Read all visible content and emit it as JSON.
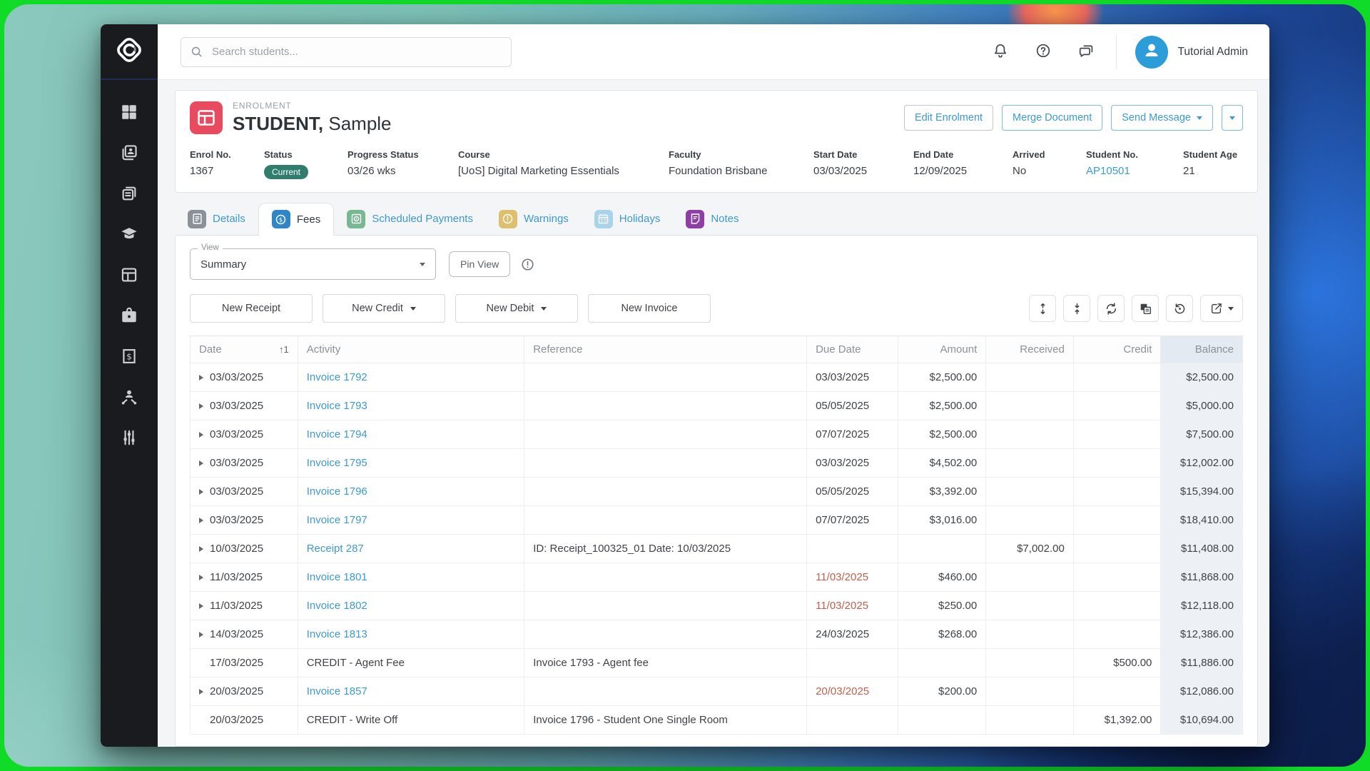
{
  "topbar": {
    "search_placeholder": "Search students...",
    "user_name": "Tutorial Admin",
    "icons": [
      "bell-icon",
      "help-icon",
      "chat-icon"
    ]
  },
  "sidebar": {
    "items": [
      {
        "id": "dashboard",
        "icon": "dashboard-icon"
      },
      {
        "id": "students",
        "icon": "students-icon"
      },
      {
        "id": "documents",
        "icon": "documents-icon"
      },
      {
        "id": "courses",
        "icon": "courses-icon"
      },
      {
        "id": "enrolments",
        "icon": "enrolments-icon"
      },
      {
        "id": "services",
        "icon": "services-icon"
      },
      {
        "id": "finance",
        "icon": "finance-icon"
      },
      {
        "id": "agents",
        "icon": "agents-icon"
      },
      {
        "id": "settings",
        "icon": "settings-icon"
      }
    ]
  },
  "enrolment": {
    "kicker": "ENROLMENT",
    "title_bold": "STUDENT,",
    "title_rest": "Sample",
    "actions": [
      {
        "id": "edit-enrolment",
        "label": "Edit Enrolment",
        "variant": "gray"
      },
      {
        "id": "merge-document",
        "label": "Merge Document",
        "variant": "blue"
      },
      {
        "id": "send-message",
        "label": "Send Message",
        "variant": "blue",
        "dropdown": true
      },
      {
        "id": "more-actions",
        "label": "",
        "variant": "blue",
        "dropdown": true,
        "compact": true
      }
    ],
    "fields": [
      {
        "label": "Enrol No.",
        "value": "1367"
      },
      {
        "label": "Status",
        "value": "Current",
        "type": "badge"
      },
      {
        "label": "Progress Status",
        "value": "03/26 wks"
      },
      {
        "label": "Course",
        "value": "[UoS] Digital Marketing Essentials"
      },
      {
        "label": "Faculty",
        "value": "Foundation Brisbane"
      },
      {
        "label": "Start Date",
        "value": "03/03/2025"
      },
      {
        "label": "End Date",
        "value": "12/09/2025"
      },
      {
        "label": "Arrived",
        "value": "No"
      },
      {
        "label": "Student No.",
        "value": "AP10501",
        "type": "link"
      },
      {
        "label": "Student Age",
        "value": "21"
      }
    ]
  },
  "tabs": [
    {
      "label": "Details",
      "icon": "details-icon",
      "color": "#8a9198",
      "active": false
    },
    {
      "label": "Fees",
      "icon": "fees-icon",
      "color": "#2e86c9",
      "active": true
    },
    {
      "label": "Scheduled Payments",
      "icon": "scheduled-payments-icon",
      "color": "#77b893",
      "active": false
    },
    {
      "label": "Warnings",
      "icon": "warnings-icon",
      "color": "#ddbf6e",
      "active": false
    },
    {
      "label": "Holidays",
      "icon": "holidays-icon",
      "color": "#a9d3e8",
      "active": false
    },
    {
      "label": "Notes",
      "icon": "notes-icon",
      "color": "#8d3fa6",
      "active": false
    }
  ],
  "fees_panel": {
    "view_label": "View",
    "view_value": "Summary",
    "pin_button": "Pin View",
    "buttons": [
      {
        "id": "new-receipt",
        "label": "New Receipt"
      },
      {
        "id": "new-credit",
        "label": "New Credit",
        "dropdown": true
      },
      {
        "id": "new-debit",
        "label": "New Debit",
        "dropdown": true
      },
      {
        "id": "new-invoice",
        "label": "New Invoice"
      }
    ],
    "tools": [
      {
        "icon": "expand-rows-icon"
      },
      {
        "icon": "collapse-rows-icon"
      },
      {
        "icon": "refresh-icon"
      },
      {
        "icon": "duplicate-icon"
      },
      {
        "icon": "history-icon"
      },
      {
        "icon": "export-icon",
        "dropdown": true
      }
    ]
  },
  "table": {
    "columns": [
      {
        "label": "Date",
        "sort": "1"
      },
      {
        "label": "Activity"
      },
      {
        "label": "Reference"
      },
      {
        "label": "Due Date"
      },
      {
        "label": "Amount",
        "align": "right"
      },
      {
        "label": "Received",
        "align": "right"
      },
      {
        "label": "Credit",
        "align": "right"
      },
      {
        "label": "Balance",
        "align": "right",
        "highlight": true
      }
    ],
    "rows": [
      {
        "expand": true,
        "date": "03/03/2025",
        "activity": "Invoice 1792",
        "link": true,
        "reference": "",
        "due": "03/03/2025",
        "overdue": false,
        "amount": "$2,500.00",
        "received": "",
        "credit": "",
        "balance": "$2,500.00"
      },
      {
        "expand": true,
        "date": "03/03/2025",
        "activity": "Invoice 1793",
        "link": true,
        "reference": "",
        "due": "05/05/2025",
        "overdue": false,
        "amount": "$2,500.00",
        "received": "",
        "credit": "",
        "balance": "$5,000.00"
      },
      {
        "expand": true,
        "date": "03/03/2025",
        "activity": "Invoice 1794",
        "link": true,
        "reference": "",
        "due": "07/07/2025",
        "overdue": false,
        "amount": "$2,500.00",
        "received": "",
        "credit": "",
        "balance": "$7,500.00"
      },
      {
        "expand": true,
        "date": "03/03/2025",
        "activity": "Invoice 1795",
        "link": true,
        "reference": "",
        "due": "03/03/2025",
        "overdue": false,
        "amount": "$4,502.00",
        "received": "",
        "credit": "",
        "balance": "$12,002.00"
      },
      {
        "expand": true,
        "date": "03/03/2025",
        "activity": "Invoice 1796",
        "link": true,
        "reference": "",
        "due": "05/05/2025",
        "overdue": false,
        "amount": "$3,392.00",
        "received": "",
        "credit": "",
        "balance": "$15,394.00"
      },
      {
        "expand": true,
        "date": "03/03/2025",
        "activity": "Invoice 1797",
        "link": true,
        "reference": "",
        "due": "07/07/2025",
        "overdue": false,
        "amount": "$3,016.00",
        "received": "",
        "credit": "",
        "balance": "$18,410.00"
      },
      {
        "expand": true,
        "date": "10/03/2025",
        "activity": "Receipt 287",
        "link": true,
        "reference": "ID: Receipt_100325_01 Date: 10/03/2025",
        "due": "",
        "overdue": false,
        "amount": "",
        "received": "$7,002.00",
        "credit": "",
        "balance": "$11,408.00"
      },
      {
        "expand": true,
        "date": "11/03/2025",
        "activity": "Invoice 1801",
        "link": true,
        "reference": "",
        "due": "11/03/2025",
        "overdue": true,
        "amount": "$460.00",
        "received": "",
        "credit": "",
        "balance": "$11,868.00"
      },
      {
        "expand": true,
        "date": "11/03/2025",
        "activity": "Invoice 1802",
        "link": true,
        "reference": "",
        "due": "11/03/2025",
        "overdue": true,
        "amount": "$250.00",
        "received": "",
        "credit": "",
        "balance": "$12,118.00"
      },
      {
        "expand": true,
        "date": "14/03/2025",
        "activity": "Invoice 1813",
        "link": true,
        "reference": "",
        "due": "24/03/2025",
        "overdue": false,
        "amount": "$268.00",
        "received": "",
        "credit": "",
        "balance": "$12,386.00"
      },
      {
        "expand": false,
        "date": "17/03/2025",
        "activity": "CREDIT - Agent Fee",
        "link": false,
        "reference": "Invoice 1793 - Agent fee",
        "due": "",
        "overdue": false,
        "amount": "",
        "received": "",
        "credit": "$500.00",
        "balance": "$11,886.00"
      },
      {
        "expand": true,
        "date": "20/03/2025",
        "activity": "Invoice 1857",
        "link": true,
        "reference": "",
        "due": "20/03/2025",
        "overdue": true,
        "amount": "$200.00",
        "received": "",
        "credit": "",
        "balance": "$12,086.00"
      },
      {
        "expand": false,
        "date": "20/03/2025",
        "activity": "CREDIT - Write Off",
        "link": false,
        "reference": "Invoice 1796 - Student One Single Room",
        "due": "",
        "overdue": false,
        "amount": "",
        "received": "",
        "credit": "$1,392.00",
        "balance": "$10,694.00"
      }
    ]
  },
  "colors": {
    "accent_blue": "#3c9ad2",
    "badge_green": "#2e7d6d",
    "enrol_red": "#e84a5f",
    "overdue_red": "#c05f4b",
    "avatar_blue": "#2c9dd8",
    "balance_col_bg": "#edf1f6"
  }
}
